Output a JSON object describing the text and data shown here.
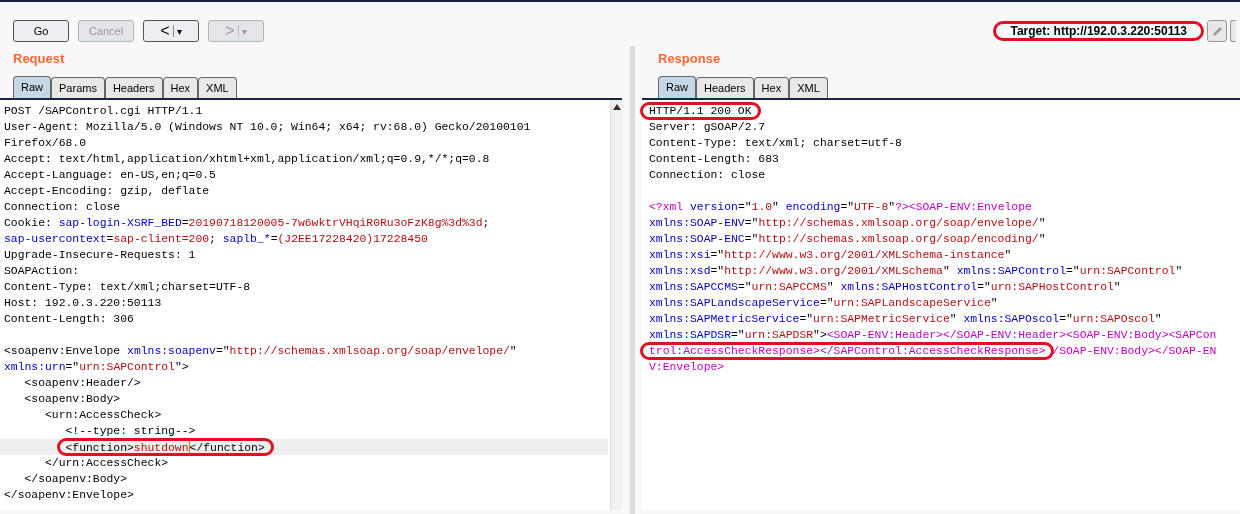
{
  "toolbar": {
    "buttons": [
      {
        "kind": "text",
        "label": "Go",
        "disabled": false
      },
      {
        "kind": "text",
        "label": "Cancel",
        "disabled": true
      },
      {
        "kind": "nav",
        "label": "<",
        "menu": "▾",
        "disabled": false
      },
      {
        "kind": "nav",
        "label": ">",
        "menu": "▾",
        "disabled": true
      }
    ],
    "target": {
      "label": "Target: http://192.0.3.220:50113",
      "circled": true
    }
  },
  "request": {
    "title": "Request",
    "tabs": [
      {
        "label": "Raw",
        "selected": true
      },
      {
        "label": "Params",
        "selected": false
      },
      {
        "label": "Headers",
        "selected": false
      },
      {
        "label": "Hex",
        "selected": false
      },
      {
        "label": "XML",
        "selected": false
      }
    ],
    "lines": [
      {
        "current": false,
        "segments": [
          {
            "kind": "plain",
            "text": "POST /SAPControl.cgi HTTP/1.1"
          }
        ]
      },
      {
        "current": false,
        "segments": [
          {
            "kind": "plain",
            "text": "User-Agent: Mozilla/5.0 (Windows NT 10.0; Win64; x64; rv:68.0) Gecko/20100101"
          }
        ]
      },
      {
        "current": false,
        "segments": [
          {
            "kind": "plain",
            "text": "Firefox/68.0"
          }
        ]
      },
      {
        "current": false,
        "segments": [
          {
            "kind": "plain",
            "text": "Accept: text/html,application/xhtml+xml,application/xml;q=0.9,*/*;q=0.8"
          }
        ]
      },
      {
        "current": false,
        "segments": [
          {
            "kind": "plain",
            "text": "Accept-Language: en-US,en;q=0.5"
          }
        ]
      },
      {
        "current": false,
        "segments": [
          {
            "kind": "plain",
            "text": "Accept-Encoding: gzip, deflate"
          }
        ]
      },
      {
        "current": false,
        "segments": [
          {
            "kind": "plain",
            "text": "Connection: close"
          }
        ]
      },
      {
        "current": false,
        "segments": [
          {
            "kind": "plain",
            "text": "Cookie: "
          },
          {
            "kind": "name",
            "text": "sap-login-XSRF_BED"
          },
          {
            "kind": "plain",
            "text": "="
          },
          {
            "kind": "value",
            "text": "20190718120005-7w6wktrVHqiR0Ru3oFzK8g%3d%3d"
          },
          {
            "kind": "plain",
            "text": ";"
          }
        ]
      },
      {
        "current": false,
        "segments": [
          {
            "kind": "name",
            "text": "sap-usercontext"
          },
          {
            "kind": "plain",
            "text": "="
          },
          {
            "kind": "value",
            "text": "sap-client=200"
          },
          {
            "kind": "plain",
            "text": "; "
          },
          {
            "kind": "name",
            "text": "saplb_*"
          },
          {
            "kind": "plain",
            "text": "="
          },
          {
            "kind": "value",
            "text": "(J2EE17228420)17228450"
          }
        ]
      },
      {
        "current": false,
        "segments": [
          {
            "kind": "plain",
            "text": "Upgrade-Insecure-Requests: 1"
          }
        ]
      },
      {
        "current": false,
        "segments": [
          {
            "kind": "plain",
            "text": "SOAPAction:"
          }
        ]
      },
      {
        "current": false,
        "segments": [
          {
            "kind": "plain",
            "text": "Content-Type: text/xml;charset=UTF-8"
          }
        ]
      },
      {
        "current": false,
        "segments": [
          {
            "kind": "plain",
            "text": "Host: 192.0.3.220:50113"
          }
        ]
      },
      {
        "current": false,
        "segments": [
          {
            "kind": "plain",
            "text": "Content-Length: 306"
          }
        ]
      },
      {
        "current": false,
        "segments": [
          {
            "kind": "blank"
          }
        ]
      },
      {
        "current": false,
        "segments": [
          {
            "kind": "plain",
            "text": "<soapenv:Envelope "
          },
          {
            "kind": "name",
            "text": "xmlns:soapenv"
          },
          {
            "kind": "plain",
            "text": "=\""
          },
          {
            "kind": "value",
            "text": "http://schemas.xmlsoap.org/soap/envelope/"
          },
          {
            "kind": "plain",
            "text": "\""
          }
        ]
      },
      {
        "current": false,
        "segments": [
          {
            "kind": "name",
            "text": "xmlns:urn"
          },
          {
            "kind": "plain",
            "text": "=\""
          },
          {
            "kind": "value",
            "text": "urn:SAPControl"
          },
          {
            "kind": "plain",
            "text": "\">"
          }
        ]
      },
      {
        "current": false,
        "segments": [
          {
            "kind": "plain",
            "text": "   <soapenv:Header/>"
          }
        ]
      },
      {
        "current": false,
        "segments": [
          {
            "kind": "plain",
            "text": "   <soapenv:Body>"
          }
        ]
      },
      {
        "current": false,
        "segments": [
          {
            "kind": "plain",
            "text": "      <urn:AccessCheck>"
          }
        ]
      },
      {
        "current": false,
        "segments": [
          {
            "kind": "plain",
            "text": "         <!--type: string-->"
          }
        ]
      },
      {
        "current": true,
        "segments": [
          {
            "kind": "indent"
          },
          {
            "kind": "indent"
          },
          {
            "kind": "indent"
          },
          {
            "kind": "circled",
            "parts": [
              {
                "kind": "plain",
                "text": "<function>"
              },
              {
                "kind": "value",
                "text": "shutdown"
              },
              {
                "kind": "cursor"
              },
              {
                "kind": "plain",
                "text": "</function>"
              }
            ]
          }
        ]
      },
      {
        "current": false,
        "segments": [
          {
            "kind": "plain",
            "text": "      </urn:AccessCheck>"
          }
        ]
      },
      {
        "current": false,
        "segments": [
          {
            "kind": "plain",
            "text": "   </soapenv:Body>"
          }
        ]
      },
      {
        "current": false,
        "segments": [
          {
            "kind": "plain",
            "text": "</soapenv:Envelope>"
          }
        ]
      }
    ]
  },
  "response": {
    "title": "Response",
    "tabs": [
      {
        "label": "Raw",
        "selected": true
      },
      {
        "label": "Headers",
        "selected": false
      },
      {
        "label": "Hex",
        "selected": false
      },
      {
        "label": "XML",
        "selected": false
      }
    ],
    "lines": [
      {
        "current": false,
        "segments": [
          {
            "kind": "circled",
            "parts": [
              {
                "kind": "plain",
                "text": "HTTP/1.1 200 OK"
              }
            ]
          }
        ]
      },
      {
        "current": false,
        "segments": [
          {
            "kind": "plain",
            "text": "Server: gSOAP/2.7"
          }
        ]
      },
      {
        "current": false,
        "segments": [
          {
            "kind": "plain",
            "text": "Content-Type: text/xml; charset=utf-8"
          }
        ]
      },
      {
        "current": false,
        "segments": [
          {
            "kind": "plain",
            "text": "Content-Length: 683"
          }
        ]
      },
      {
        "current": false,
        "segments": [
          {
            "kind": "plain",
            "text": "Connection: close"
          }
        ]
      },
      {
        "current": false,
        "segments": [
          {
            "kind": "blank"
          }
        ]
      },
      {
        "current": false,
        "segments": [
          {
            "kind": "tag",
            "text": "<?xml "
          },
          {
            "kind": "name",
            "text": "version"
          },
          {
            "kind": "plain",
            "text": "=\""
          },
          {
            "kind": "value",
            "text": "1.0"
          },
          {
            "kind": "plain",
            "text": "\" "
          },
          {
            "kind": "name",
            "text": "encoding"
          },
          {
            "kind": "plain",
            "text": "=\""
          },
          {
            "kind": "value",
            "text": "UTF-8"
          },
          {
            "kind": "plain",
            "text": "\""
          },
          {
            "kind": "tag",
            "text": "?><SOAP-ENV:Envelope"
          }
        ]
      },
      {
        "current": false,
        "segments": [
          {
            "kind": "name",
            "text": "xmlns:SOAP-ENV"
          },
          {
            "kind": "plain",
            "text": "=\""
          },
          {
            "kind": "value",
            "text": "http://schemas.xmlsoap.org/soap/envelope/"
          },
          {
            "kind": "plain",
            "text": "\""
          }
        ]
      },
      {
        "current": false,
        "segments": [
          {
            "kind": "name",
            "text": "xmlns:SOAP-ENC"
          },
          {
            "kind": "plain",
            "text": "=\""
          },
          {
            "kind": "value",
            "text": "http://schemas.xmlsoap.org/soap/encoding/"
          },
          {
            "kind": "plain",
            "text": "\""
          }
        ]
      },
      {
        "current": false,
        "segments": [
          {
            "kind": "name",
            "text": "xmlns:xsi"
          },
          {
            "kind": "plain",
            "text": "=\""
          },
          {
            "kind": "value",
            "text": "http://www.w3.org/2001/XMLSchema-instance"
          },
          {
            "kind": "plain",
            "text": "\""
          }
        ]
      },
      {
        "current": false,
        "segments": [
          {
            "kind": "name",
            "text": "xmlns:xsd"
          },
          {
            "kind": "plain",
            "text": "=\""
          },
          {
            "kind": "value",
            "text": "http://www.w3.org/2001/XMLSchema"
          },
          {
            "kind": "plain",
            "text": "\" "
          },
          {
            "kind": "name",
            "text": "xmlns:SAPControl"
          },
          {
            "kind": "plain",
            "text": "=\""
          },
          {
            "kind": "value",
            "text": "urn:SAPControl"
          },
          {
            "kind": "plain",
            "text": "\""
          }
        ]
      },
      {
        "current": false,
        "segments": [
          {
            "kind": "name",
            "text": "xmlns:SAPCCMS"
          },
          {
            "kind": "plain",
            "text": "=\""
          },
          {
            "kind": "value",
            "text": "urn:SAPCCMS"
          },
          {
            "kind": "plain",
            "text": "\" "
          },
          {
            "kind": "name",
            "text": "xmlns:SAPHostControl"
          },
          {
            "kind": "plain",
            "text": "=\""
          },
          {
            "kind": "value",
            "text": "urn:SAPHostControl"
          },
          {
            "kind": "plain",
            "text": "\""
          }
        ]
      },
      {
        "current": false,
        "segments": [
          {
            "kind": "name",
            "text": "xmlns:SAPLandscapeService"
          },
          {
            "kind": "plain",
            "text": "=\""
          },
          {
            "kind": "value",
            "text": "urn:SAPLandscapeService"
          },
          {
            "kind": "plain",
            "text": "\""
          }
        ]
      },
      {
        "current": false,
        "segments": [
          {
            "kind": "name",
            "text": "xmlns:SAPMetricService"
          },
          {
            "kind": "plain",
            "text": "=\""
          },
          {
            "kind": "value",
            "text": "urn:SAPMetricService"
          },
          {
            "kind": "plain",
            "text": "\" "
          },
          {
            "kind": "name",
            "text": "xmlns:SAPOscol"
          },
          {
            "kind": "plain",
            "text": "=\""
          },
          {
            "kind": "value",
            "text": "urn:SAPOscol"
          },
          {
            "kind": "plain",
            "text": "\""
          }
        ]
      },
      {
        "current": false,
        "segments": [
          {
            "kind": "name",
            "text": "xmlns:SAPDSR"
          },
          {
            "kind": "plain",
            "text": "=\""
          },
          {
            "kind": "value",
            "text": "urn:SAPDSR"
          },
          {
            "kind": "plain",
            "text": "\">"
          },
          {
            "kind": "tag",
            "text": "<SOAP-ENV:Header></SOAP-ENV:Header><SOAP-ENV:Body><SAPCon"
          }
        ]
      },
      {
        "current": false,
        "segments": [
          {
            "kind": "circled",
            "parts": [
              {
                "kind": "tag",
                "text": "trol:AccessCheckResponse></SAPControl:AccessCheckResponse>"
              }
            ]
          },
          {
            "kind": "tag",
            "text": " /SOAP-ENV:Body></SOAP-EN"
          }
        ]
      },
      {
        "current": false,
        "segments": [
          {
            "kind": "tag",
            "text": "V:Envelope>"
          }
        ]
      }
    ]
  }
}
